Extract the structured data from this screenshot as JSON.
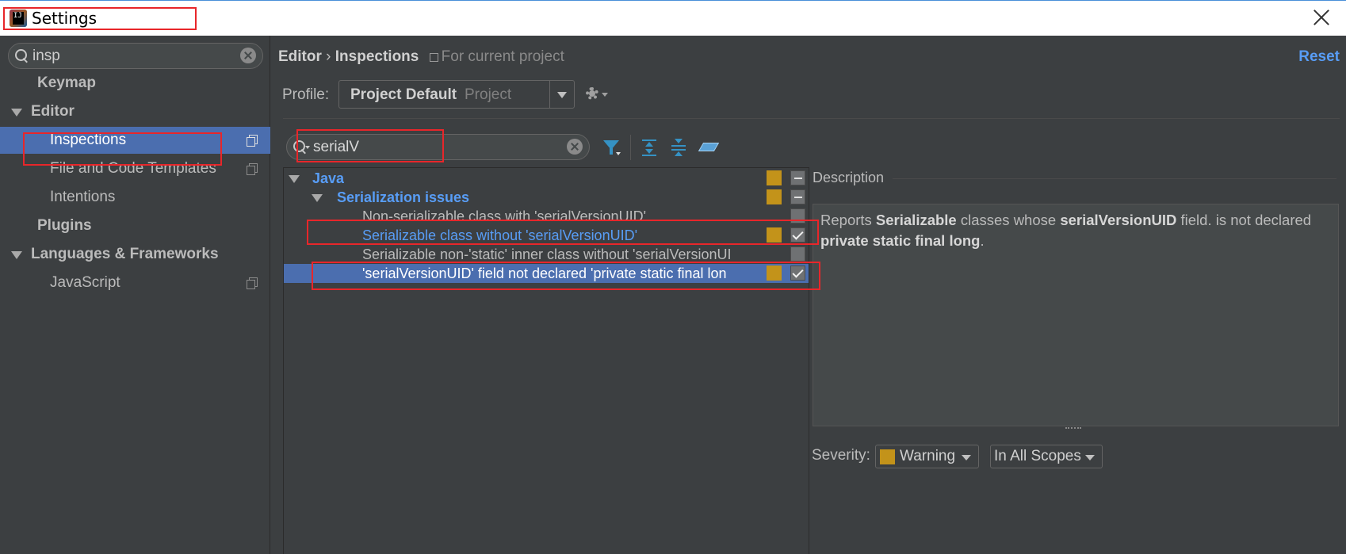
{
  "window": {
    "title": "Settings"
  },
  "left_panel": {
    "search_value": "insp",
    "items": [
      {
        "label": "Keymap"
      },
      {
        "label": "Editor"
      },
      {
        "label": "Inspections"
      },
      {
        "label": "File and Code Templates"
      },
      {
        "label": "Intentions"
      },
      {
        "label": "Plugins"
      },
      {
        "label": "Languages & Frameworks"
      },
      {
        "label": "JavaScript"
      }
    ]
  },
  "header": {
    "breadcrumb_root": "Editor",
    "breadcrumb_sep": "›",
    "breadcrumb_page": "Inspections",
    "scope_note": "For current project",
    "reset_label": "Reset"
  },
  "profile": {
    "label": "Profile:",
    "value": "Project Default",
    "type": "Project"
  },
  "filter": {
    "value": "serialV"
  },
  "tree": {
    "rows": [
      {
        "label": "Java",
        "checkbox": "mixed"
      },
      {
        "label": "Serialization issues",
        "checkbox": "mixed"
      },
      {
        "label": "Non-serializable class with 'serialVersionUID'",
        "checkbox": "unchecked"
      },
      {
        "label": "Serializable class without 'serialVersionUID'",
        "checkbox": "checked"
      },
      {
        "label": "Serializable non-'static' inner class without 'serialVersionUI",
        "checkbox": "unchecked"
      },
      {
        "label": "'serialVersionUID' field not declared 'private static final lon",
        "checkbox": "checked"
      }
    ]
  },
  "description": {
    "title": "Description",
    "t1": "Reports ",
    "b1": "Serializable",
    "t2": " classes whose ",
    "b2": "serialVersionUID",
    "t3": " field. is not declared ",
    "b3": "private static final long",
    "t4": "."
  },
  "severity": {
    "label": "Severity:",
    "value": "Warning",
    "scope": "In All Scopes"
  },
  "colors": {
    "accent": "#4b6eaf",
    "link": "#589df6",
    "warning": "#c3931a",
    "annotation": "#e8262a"
  }
}
